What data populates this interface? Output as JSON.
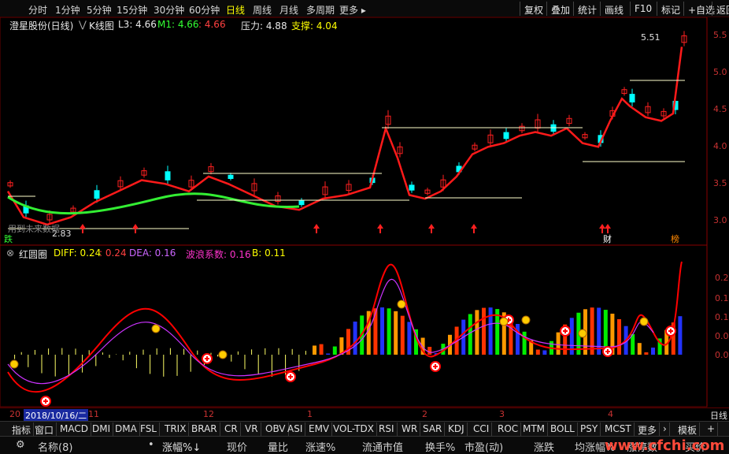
{
  "periods": [
    {
      "label": "分时",
      "on": false
    },
    {
      "label": "1分钟",
      "on": false
    },
    {
      "label": "5分钟",
      "on": false
    },
    {
      "label": "15分钟",
      "on": false
    },
    {
      "label": "30分钟",
      "on": false
    },
    {
      "label": "60分钟",
      "on": false
    },
    {
      "label": "日线",
      "on": true
    },
    {
      "label": "周线",
      "on": false
    },
    {
      "label": "月线",
      "on": false
    },
    {
      "label": "多周期",
      "on": false
    },
    {
      "label": "更多 ▸",
      "on": false
    }
  ],
  "right_buttons": [
    "复权",
    "叠加",
    "统计",
    "画线",
    "F10",
    "标记",
    "+自选",
    "返回"
  ],
  "kline": {
    "stock": "澄星股份(日线)",
    "chart_label": "K线图",
    "l3": "L3: 4.66",
    "m1": "M1: 4.66",
    "x": ": 4.66",
    "pressure": "压力: 4.88",
    "support": "支撑: 4.04",
    "high_label": "5.51",
    "low_label": "2.83",
    "prefix_mark": "⋁",
    "watermark_left": "用到未来数据",
    "flags": {
      "left": "跌",
      "mid": "财",
      "right": "榜"
    }
  },
  "indicator": {
    "name": "红圆圈",
    "diff": "DIFF: 0.24",
    "dup": ": 0.24",
    "dea": "DEA: 0.16",
    "wave": "波浪系数: 0.16",
    "b": "B: 0.11",
    "close_icon": "⊗"
  },
  "price_axis": [
    "5.5",
    "5.0",
    "4.5",
    "4.0",
    "3.5",
    "3.0"
  ],
  "ind_axis": [
    "0.2",
    "0.1",
    "0.1",
    "0.0",
    "0.0"
  ],
  "dates": {
    "prefix": "20",
    "selected": "2018/10/16/二",
    "m11": "11",
    "m12": "12",
    "m1": "1",
    "m2": "2",
    "m3": "3",
    "m4": "4",
    "right": "日线"
  },
  "tabs": [
    "指标",
    "窗口",
    "MACD",
    "DMI",
    "DMA",
    "FSL",
    "TRIX",
    "BRAR",
    "CR",
    "VR",
    "OBV",
    "ASI",
    "EMV",
    "VOL-TDX",
    "RSI",
    "WR",
    "SAR",
    "KDJ",
    "CCI",
    "ROC",
    "MTM",
    "BOLL",
    "PSY",
    "MCST",
    "更多",
    "›",
    "模板",
    "+"
  ],
  "columns": [
    "⚙",
    "名称(8)",
    "•",
    "涨幅%↓",
    "现价",
    "量比",
    "涨速%",
    "流通市值",
    "换手%",
    "市盈(动)",
    "涨跌",
    "均涨幅%",
    "涨停数",
    "买价"
  ],
  "watermark": "www.cfchi.com",
  "colors": {
    "up": "#ff2020",
    "down": "#00ffff",
    "ma": "#ff1a1a",
    "ma2": "#33ee33",
    "diff": "#ff0000",
    "dea": "#cc33ff",
    "accent": "#ffff00"
  },
  "chart_data": {
    "type": "candlestick",
    "title": "",
    "ylim": [
      2.75,
      5.65
    ],
    "highlights": {
      "high": 5.51,
      "low": 2.83,
      "pressure": 4.88,
      "support": 4.04
    }
  }
}
